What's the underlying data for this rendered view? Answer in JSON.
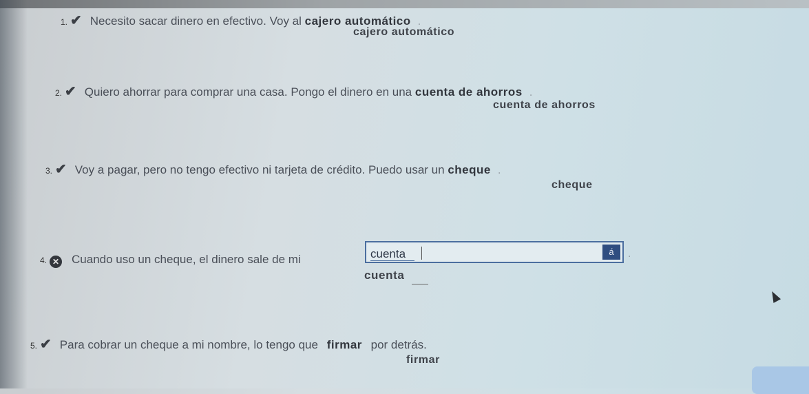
{
  "questions": [
    {
      "number": "1.",
      "icon": "check-icon",
      "prompt": "Necesito sacar dinero en efectivo. Voy al",
      "answer": "cajero automático",
      "suffix": ".",
      "correct": "cajero automático"
    },
    {
      "number": "2.",
      "icon": "check-icon",
      "prompt": "Quiero ahorrar para comprar una casa. Pongo el dinero en una",
      "answer": "cuenta de ahorros",
      "suffix": ".",
      "correct": "cuenta de ahorros"
    },
    {
      "number": "3.",
      "icon": "check-icon",
      "prompt": "Voy a pagar, pero no tengo efectivo ni tarjeta de crédito. Puedo usar un",
      "answer": "cheque",
      "suffix": ".",
      "correct": "cheque"
    },
    {
      "number": "4.",
      "icon": "x-icon",
      "prompt": "Cuando uso un cheque, el dinero sale de mi",
      "input_value": "cuenta",
      "accent_button": "á",
      "suffix": ".",
      "correct": "cuenta"
    },
    {
      "number": "5.",
      "icon": "check-icon",
      "prompt": "Para cobrar un cheque a mi nombre, lo tengo que",
      "answer": "firmar",
      "suffix": "por detrás.",
      "correct": "firmar"
    }
  ],
  "colors": {
    "input_border": "#4b6e9f",
    "accent_button_bg": "#2f4d80",
    "incorrect_icon": "#33363c"
  }
}
